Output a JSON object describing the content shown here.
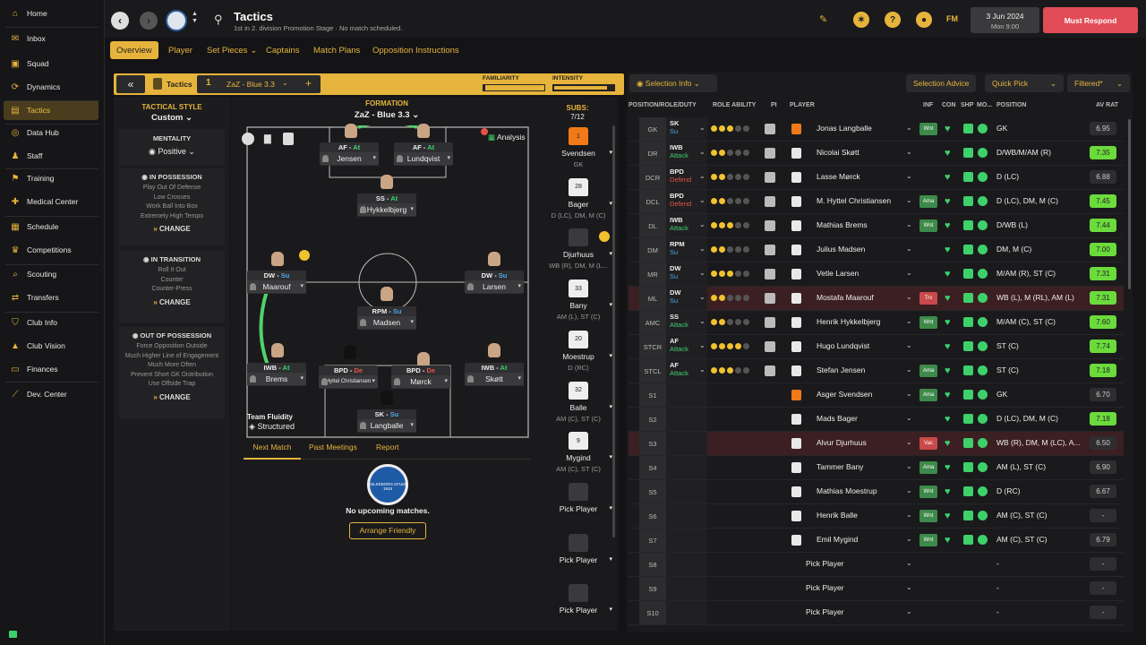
{
  "sidebar": {
    "items": [
      {
        "label": "Home",
        "icon": "home-icon"
      },
      {
        "label": "Inbox",
        "icon": "inbox-icon"
      },
      {
        "label": "Squad",
        "icon": "squad-icon"
      },
      {
        "label": "Dynamics",
        "icon": "dynamics-icon"
      },
      {
        "label": "Tactics",
        "icon": "tactics-icon",
        "active": true
      },
      {
        "label": "Data Hub",
        "icon": "data-hub-icon"
      },
      {
        "label": "Staff",
        "icon": "staff-icon"
      },
      {
        "label": "Training",
        "icon": "training-icon"
      },
      {
        "label": "Medical Center",
        "icon": "medical-icon"
      },
      {
        "label": "Schedule",
        "icon": "schedule-icon"
      },
      {
        "label": "Competitions",
        "icon": "trophy-icon"
      },
      {
        "label": "Scouting",
        "icon": "scouting-icon"
      },
      {
        "label": "Transfers",
        "icon": "transfers-icon"
      },
      {
        "label": "Club Info",
        "icon": "club-info-icon"
      },
      {
        "label": "Club Vision",
        "icon": "club-vision-icon"
      },
      {
        "label": "Finances",
        "icon": "finances-icon"
      },
      {
        "label": "Dev. Center",
        "icon": "dev-center-icon"
      }
    ]
  },
  "header": {
    "title": "Tactics",
    "subtitle": "1st in 2. division Promotion Stage · No match scheduled.",
    "date": "3 Jun 2024",
    "time": "Mon 9:00",
    "must_respond": "Must Respond",
    "fm": "FM"
  },
  "subnav": [
    "Overview",
    "Player",
    "Set Pieces",
    "Captains",
    "Match Plans",
    "Opposition Instructions"
  ],
  "tacbar": {
    "tactics": "Tactics",
    "slot": "1",
    "name": "ZaZ - Blue 3.3",
    "familiarity": "FAMILIARITY",
    "intensity": "INTENSITY"
  },
  "style": {
    "title": "TACTICAL STYLE",
    "value": "Custom",
    "mentality_label": "MENTALITY",
    "mentality": "Positive",
    "in_possession": "IN POSSESSION",
    "ip_items": [
      "Play Out Of Defense",
      "Low Crosses",
      "Work Ball Into Box",
      "Extremely High Tempo"
    ],
    "in_transition": "IN TRANSITION",
    "it_items": [
      "Roll It Out",
      "Counter",
      "Counter-Press"
    ],
    "out_possession": "OUT OF POSSESSION",
    "op_items": [
      "Force Opposition Outside",
      "Much Higher Line of Engagement",
      "Much More Often",
      "Prevent Short GK Distribution",
      "Use Offside Trap"
    ],
    "change": "CHANGE"
  },
  "formation": {
    "label": "FORMATION",
    "name": "ZaZ - Blue 3.3",
    "analysis": "Analysis",
    "fluidity_label": "Team Fluidity",
    "fluidity": "Structured"
  },
  "pitch_players": [
    {
      "role": "AF",
      "duty": "At",
      "name": "Jensen"
    },
    {
      "role": "AF",
      "duty": "At",
      "name": "Lundqvist"
    },
    {
      "role": "SS",
      "duty": "At",
      "name": "Hykkelbjerg"
    },
    {
      "role": "DW",
      "duty": "Su",
      "name": "Maarouf"
    },
    {
      "role": "DW",
      "duty": "Su",
      "name": "Larsen"
    },
    {
      "role": "RPM",
      "duty": "Su",
      "name": "Madsen"
    },
    {
      "role": "IWB",
      "duty": "At",
      "name": "Brems"
    },
    {
      "role": "BPD",
      "duty": "De",
      "name": "Hyttel Christiansen"
    },
    {
      "role": "BPD",
      "duty": "De",
      "name": "Mørck"
    },
    {
      "role": "IWB",
      "duty": "At",
      "name": "Skøtt"
    },
    {
      "role": "SK",
      "duty": "Su",
      "name": "Langballe"
    }
  ],
  "match_tabs": [
    "Next Match",
    "Past Meetings",
    "Report"
  ],
  "no_matches": "No upcoming matches.",
  "arrange": "Arrange Friendly",
  "club_badge_text": "SILKEBORG KFUM 1918",
  "subs": {
    "label": "SUBS:",
    "count": "7/12",
    "list": [
      {
        "no": "1",
        "name": "Svendsen",
        "pos": "GK"
      },
      {
        "no": "28",
        "name": "Bager",
        "pos": "D (LC), DM, M (C)"
      },
      {
        "no": "",
        "name": "Djurhuus",
        "pos": "WB (R), DM, M (L..."
      },
      {
        "no": "33",
        "name": "Bany",
        "pos": "AM (L), ST (C)"
      },
      {
        "no": "20",
        "name": "Moestrup",
        "pos": "D (RC)"
      },
      {
        "no": "32",
        "name": "Balle",
        "pos": "AM (C), ST (C)"
      },
      {
        "no": "9",
        "name": "Mygind",
        "pos": "AM (C), ST (C)"
      },
      {
        "no": "",
        "name": "Pick Player",
        "pos": ""
      },
      {
        "no": "",
        "name": "Pick Player",
        "pos": ""
      },
      {
        "no": "",
        "name": "Pick Player",
        "pos": ""
      }
    ]
  },
  "right": {
    "selection_info": "Selection Info",
    "selection_advice": "Selection Advice",
    "quick_pick": "Quick Pick",
    "filtered": "Filtered*",
    "columns": [
      "POSITION/ROLE/DUTY",
      "ROLE ABILITY",
      "PI",
      "PLAYER",
      "INF",
      "CON",
      "SHP",
      "MO...",
      "POSITION",
      "AV RAT"
    ],
    "rows": [
      {
        "pos": "GK",
        "role": "SK",
        "duty": "Su",
        "stars": 2.5,
        "name": "Jonas Langballe",
        "inf": "Wnt",
        "position": "GK",
        "av": "6.95",
        "green": false
      },
      {
        "pos": "DR",
        "role": "IWB",
        "duty": "Attack",
        "stars": 2,
        "name": "Nicolai Skøtt",
        "inf": "",
        "position": "D/WB/M/AM (R)",
        "av": "7.35",
        "green": true
      },
      {
        "pos": "DCR",
        "role": "BPD",
        "duty": "Defend",
        "stars": 2,
        "name": "Lasse Mørck",
        "inf": "",
        "position": "D (LC)",
        "av": "6.88",
        "green": false
      },
      {
        "pos": "DCL",
        "role": "BPD",
        "duty": "Defend",
        "stars": 2,
        "name": "M. Hyttel Christiansen",
        "inf": "Ama",
        "position": "D (LC), DM, M (C)",
        "av": "7.45",
        "green": true
      },
      {
        "pos": "DL",
        "role": "IWB",
        "duty": "Attack",
        "stars": 2.5,
        "name": "Mathias Brems",
        "inf": "Wnt",
        "position": "D/WB (L)",
        "av": "7.44",
        "green": true
      },
      {
        "pos": "DM",
        "role": "RPM",
        "duty": "Su",
        "stars": 1.5,
        "name": "Julius Madsen",
        "inf": "",
        "position": "DM, M (C)",
        "av": "7.00",
        "green": true
      },
      {
        "pos": "MR",
        "role": "DW",
        "duty": "Su",
        "stars": 2.5,
        "name": "Vetle Larsen",
        "inf": "",
        "position": "M/AM (R), ST (C)",
        "av": "7.31",
        "green": true
      },
      {
        "pos": "ML",
        "role": "DW",
        "duty": "Su",
        "stars": 2,
        "name": "Mostafa Maarouf",
        "inf": "Trv",
        "position": "WB (L), M (RL), AM (L)",
        "av": "7.31",
        "green": true,
        "hl": true
      },
      {
        "pos": "AMC",
        "role": "SS",
        "duty": "Attack",
        "stars": 2,
        "name": "Henrik Hykkelbjerg",
        "inf": "Wnt",
        "position": "M/AM (C), ST (C)",
        "av": "7.60",
        "green": true
      },
      {
        "pos": "STCR",
        "role": "AF",
        "duty": "Attack",
        "stars": 3.5,
        "name": "Hugo Lundqvist",
        "inf": "",
        "position": "ST (C)",
        "av": "7.74",
        "green": true
      },
      {
        "pos": "STCL",
        "role": "AF",
        "duty": "Attack",
        "stars": 3,
        "name": "Stefan Jensen",
        "inf": "Ama",
        "position": "ST (C)",
        "av": "7.18",
        "green": true
      },
      {
        "pos": "S1",
        "role": "",
        "duty": "",
        "stars": 0,
        "name": "Asger Svendsen",
        "inf": "Ama",
        "position": "GK",
        "av": "6.70",
        "green": false
      },
      {
        "pos": "S2",
        "role": "",
        "duty": "",
        "stars": 0,
        "name": "Mads Bager",
        "inf": "",
        "position": "D (LC), DM, M (C)",
        "av": "7.18",
        "green": true
      },
      {
        "pos": "S3",
        "role": "",
        "duty": "",
        "stars": 0,
        "name": "Alvur Djurhuus",
        "inf": "Vac",
        "position": "WB (R), DM, M (LC), A...",
        "av": "6.50",
        "green": false,
        "hl": true
      },
      {
        "pos": "S4",
        "role": "",
        "duty": "",
        "stars": 0,
        "name": "Tammer Bany",
        "inf": "Ama",
        "position": "AM (L), ST (C)",
        "av": "6.90",
        "green": false
      },
      {
        "pos": "S5",
        "role": "",
        "duty": "",
        "stars": 0,
        "name": "Mathias Moestrup",
        "inf": "Wnt",
        "position": "D (RC)",
        "av": "6.67",
        "green": false
      },
      {
        "pos": "S6",
        "role": "",
        "duty": "",
        "stars": 0,
        "name": "Henrik Balle",
        "inf": "Wnt",
        "position": "AM (C), ST (C)",
        "av": "-",
        "green": false
      },
      {
        "pos": "S7",
        "role": "",
        "duty": "",
        "stars": 0,
        "name": "Emil Mygind",
        "inf": "Wnt",
        "position": "AM (C), ST (C)",
        "av": "6.79",
        "green": false
      },
      {
        "pos": "S8",
        "role": "",
        "duty": "",
        "stars": 0,
        "name": "Pick Player",
        "inf": "",
        "position": "-",
        "av": "-",
        "green": false,
        "empty": true
      },
      {
        "pos": "S9",
        "role": "",
        "duty": "",
        "stars": 0,
        "name": "Pick Player",
        "inf": "",
        "position": "-",
        "av": "-",
        "green": false,
        "empty": true
      },
      {
        "pos": "S10",
        "role": "",
        "duty": "",
        "stars": 0,
        "name": "Pick Player",
        "inf": "",
        "position": "-",
        "av": "-",
        "green": false,
        "empty": true
      }
    ]
  },
  "colors": {
    "accent": "#e6b43c",
    "danger": "#e6534a",
    "good": "#6bdb3c"
  }
}
